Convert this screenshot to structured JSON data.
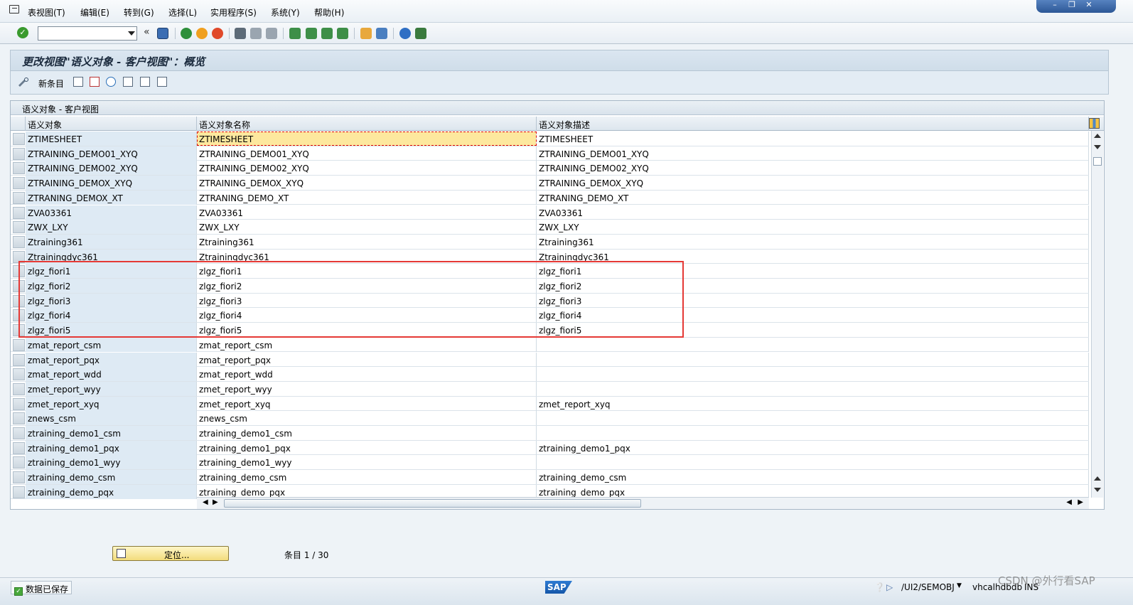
{
  "menu": {
    "items": [
      "表视图(T)",
      "编辑(E)",
      "转到(G)",
      "选择(L)",
      "实用程序(S)",
      "系统(Y)",
      "帮助(H)"
    ]
  },
  "toolbar": {
    "command_field": "",
    "colors": {
      "ok": "#3a9a2e",
      "cancel": "#e0492a",
      "back": "#2e8f3b"
    }
  },
  "page": {
    "title": "更改视图\"语义对象 - 客户视图\"：概览"
  },
  "app_toolbar": {
    "new_entries": "新条目"
  },
  "table": {
    "caption": "语义对象 - 客户视图",
    "columns": [
      "语义对象",
      "语义对象名称",
      "语义对象描述"
    ],
    "rows": [
      [
        "ZTIMESHEET",
        "ZTIMESHEET",
        "ZTIMESHEET"
      ],
      [
        "ZTRAINING_DEMO01_XYQ",
        "ZTRAINING_DEMO01_XYQ",
        "ZTRAINING_DEMO01_XYQ"
      ],
      [
        "ZTRAINING_DEMO02_XYQ",
        "ZTRAINING_DEMO02_XYQ",
        "ZTRAINING_DEMO02_XYQ"
      ],
      [
        "ZTRAINING_DEMOX_XYQ",
        "ZTRAINING_DEMOX_XYQ",
        "ZTRAINING_DEMOX_XYQ"
      ],
      [
        "ZTRANING_DEMOX_XT",
        "ZTRANING_DEMO_XT",
        "ZTRANING_DEMO_XT"
      ],
      [
        "ZVA03361",
        "ZVA03361",
        "ZVA03361"
      ],
      [
        "ZWX_LXY",
        "ZWX_LXY",
        "ZWX_LXY"
      ],
      [
        "Ztraining361",
        "Ztraining361",
        "Ztraining361"
      ],
      [
        "Ztrainingdyc361",
        "Ztrainingdyc361",
        "Ztrainingdyc361"
      ],
      [
        "zlgz_fiori1",
        "zlgz_fiori1",
        "zlgz_fiori1"
      ],
      [
        "zlgz_fiori2",
        "zlgz_fiori2",
        "zlgz_fiori2"
      ],
      [
        "zlgz_fiori3",
        "zlgz_fiori3",
        "zlgz_fiori3"
      ],
      [
        "zlgz_fiori4",
        "zlgz_fiori4",
        "zlgz_fiori4"
      ],
      [
        "zlgz_fiori5",
        "zlgz_fiori5",
        "zlgz_fiori5"
      ],
      [
        "zmat_report_csm",
        "zmat_report_csm",
        ""
      ],
      [
        "zmat_report_pqx",
        "zmat_report_pqx",
        ""
      ],
      [
        "zmat_report_wdd",
        "zmat_report_wdd",
        ""
      ],
      [
        "zmet_report_wyy",
        "zmet_report_wyy",
        ""
      ],
      [
        "zmet_report_xyq",
        "zmet_report_xyq",
        "zmet_report_xyq"
      ],
      [
        "znews_csm",
        "znews_csm",
        ""
      ],
      [
        "ztraining_demo1_csm",
        "ztraining_demo1_csm",
        ""
      ],
      [
        "ztraining_demo1_pqx",
        "ztraining_demo1_pqx",
        "ztraining_demo1_pqx"
      ],
      [
        "ztraining_demo1_wyy",
        "ztraining_demo1_wyy",
        ""
      ],
      [
        "ztraining_demo_csm",
        "ztraining_demo_csm",
        "ztraining_demo_csm"
      ],
      [
        "ztraining_demo_pqx",
        "ztraining_demo_pqx",
        "ztraining_demo_pqx"
      ]
    ],
    "highlight_color": "#e53935"
  },
  "footer": {
    "locate_button": "定位...",
    "entry_counter": "条目 1 / 30"
  },
  "statusbar": {
    "message": "数据已保存",
    "transaction": "/UI2/SEMOBJ",
    "server": "vhcalhdbdb",
    "mode": "INS",
    "sap_logo": "SAP"
  },
  "watermark": "CSDN @外行看SAP"
}
